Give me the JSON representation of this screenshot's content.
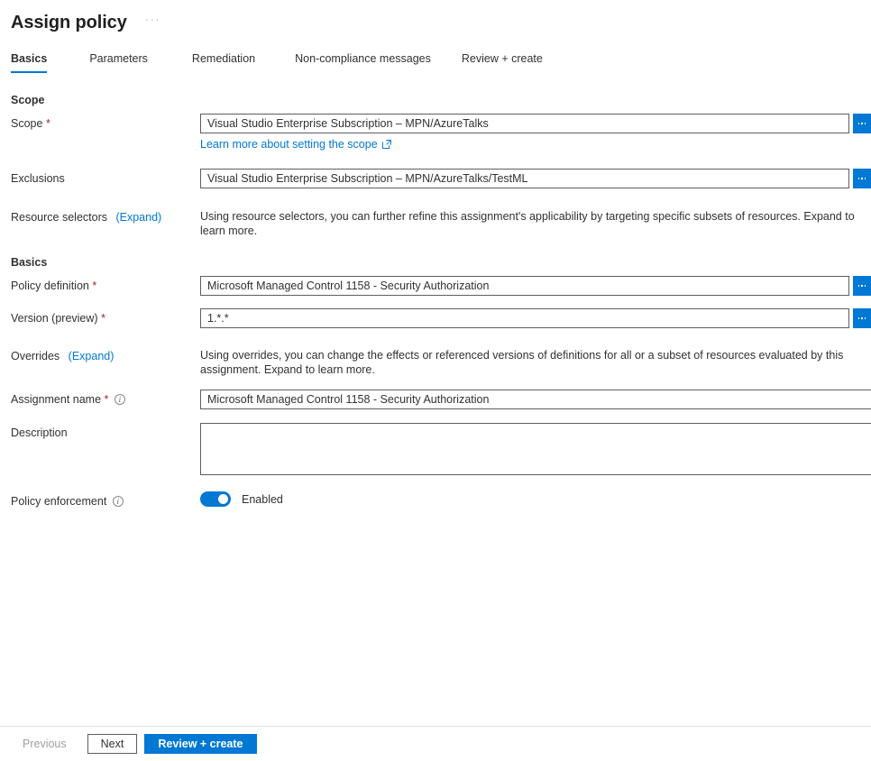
{
  "header": {
    "title": "Assign policy",
    "more_ellipsis": "···"
  },
  "tabs": [
    {
      "label": "Basics",
      "selected": true
    },
    {
      "label": "Parameters",
      "selected": false
    },
    {
      "label": "Remediation",
      "selected": false
    },
    {
      "label": "Non-compliance messages",
      "selected": false
    },
    {
      "label": "Review + create",
      "selected": false
    }
  ],
  "scope_section": {
    "heading": "Scope",
    "scope": {
      "label": "Scope",
      "required_mark": "*",
      "value": "Visual Studio Enterprise Subscription – MPN/AzureTalks",
      "browse_button": "browse-ellipsis-button",
      "helper_link": "Learn more about setting the scope"
    },
    "exclusions": {
      "label": "Exclusions",
      "value": "Visual Studio Enterprise Subscription – MPN/AzureTalks/TestML",
      "browse_button": "browse-ellipsis-button"
    },
    "resource_selectors": {
      "label": "Resource selectors",
      "expand_label": "(Expand)",
      "description": "Using resource selectors, you can further refine this assignment's applicability by targeting specific subsets of resources. Expand to learn more."
    }
  },
  "basics_section": {
    "heading": "Basics",
    "policy_definition": {
      "label": "Policy definition",
      "required_mark": "*",
      "value": "Microsoft Managed Control 1158 - Security Authorization",
      "browse_button": "browse-ellipsis-button"
    },
    "version": {
      "label": "Version (preview)",
      "required_mark": "*",
      "value": "1.*.*",
      "browse_button": "browse-ellipsis-button"
    },
    "overrides": {
      "label": "Overrides",
      "expand_label": "(Expand)",
      "description": "Using overrides, you can change the effects or referenced versions of definitions for all or a subset of resources evaluated by this assignment. Expand to learn more."
    },
    "assignment_name": {
      "label": "Assignment name",
      "required_mark": "*",
      "value": "Microsoft Managed Control 1158 - Security Authorization"
    },
    "description": {
      "label": "Description",
      "value": ""
    },
    "policy_enforcement": {
      "label": "Policy enforcement",
      "state": "Enabled",
      "on": true
    }
  },
  "footer": {
    "previous": "Previous",
    "next": "Next",
    "review_create": "Review + create"
  },
  "colors": {
    "accent": "#0078d4",
    "required": "#a4262c",
    "text": "#323130",
    "border": "#605e5c"
  }
}
